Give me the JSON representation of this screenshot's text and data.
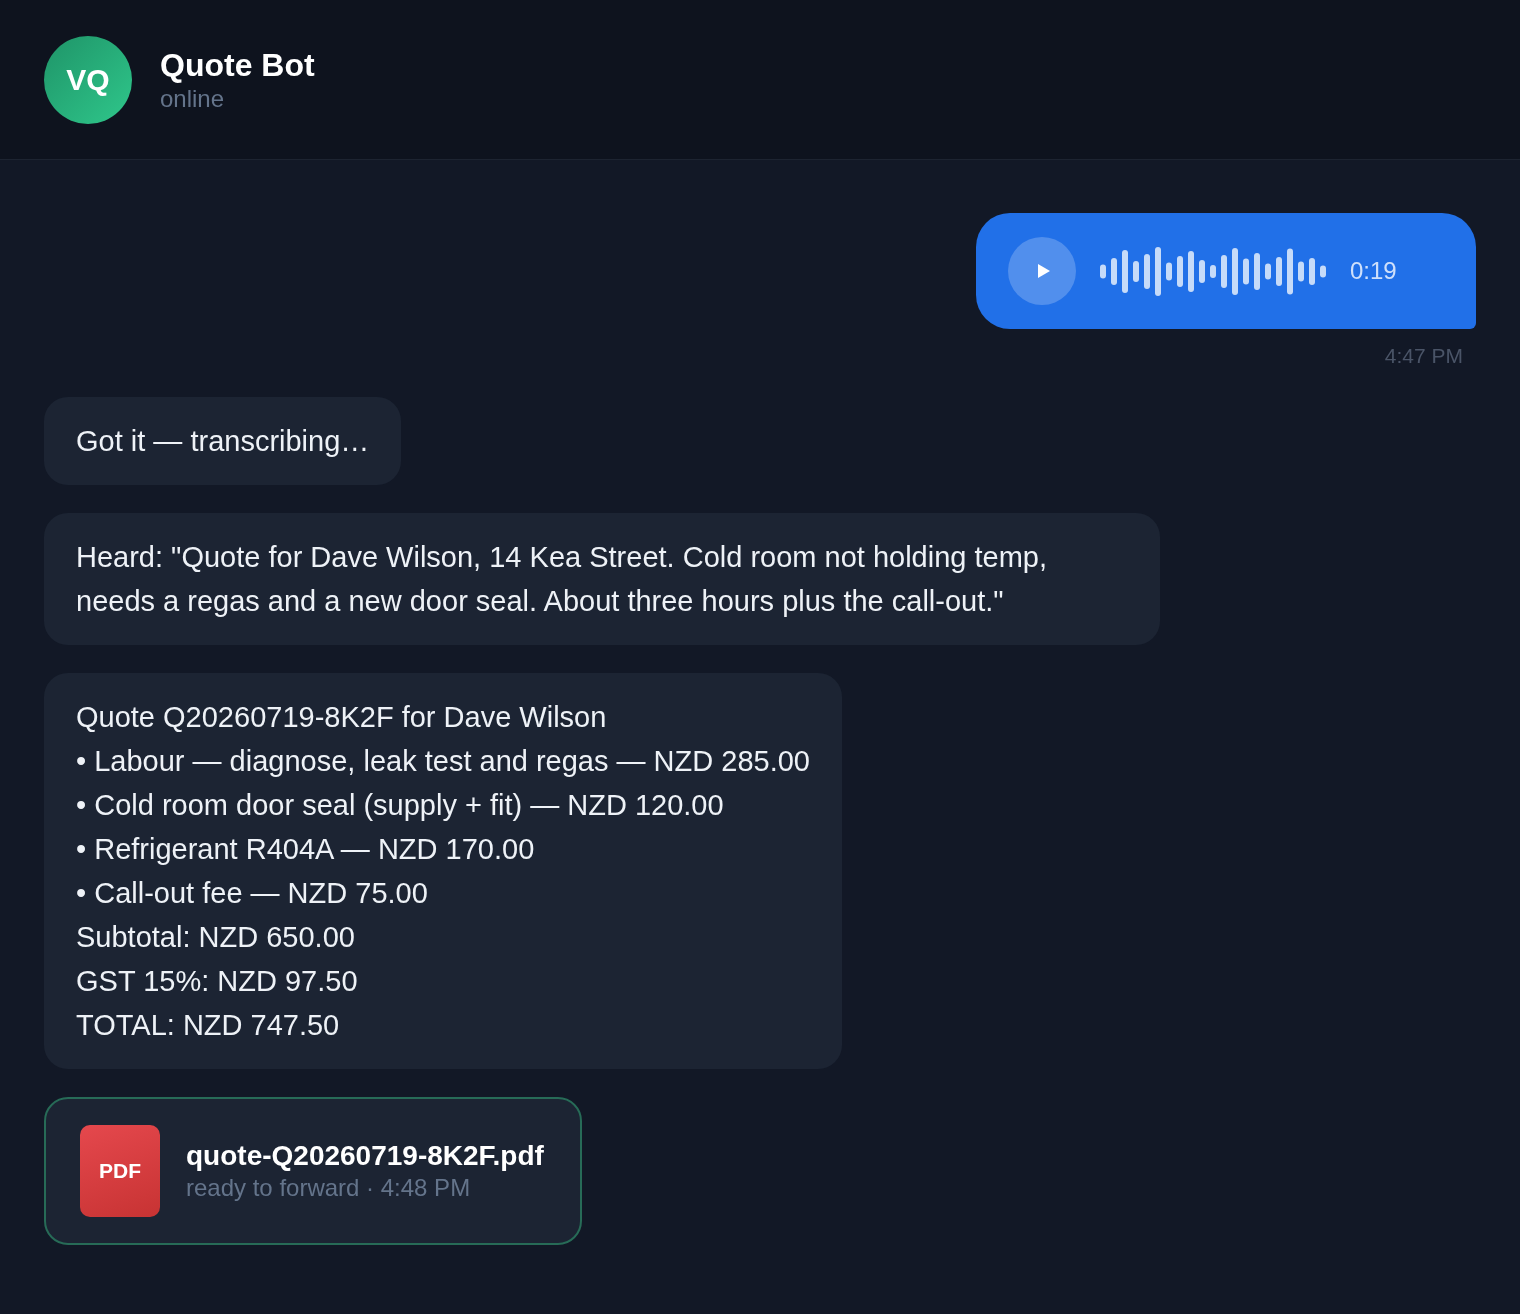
{
  "header": {
    "avatar_initials": "VQ",
    "title": "Quote Bot",
    "status": "online"
  },
  "messages": [
    {
      "kind": "voice",
      "outgoing": true,
      "duration": "0:19",
      "time": "4:47 PM"
    },
    {
      "kind": "text",
      "outgoing": false,
      "lines": [
        "Got it — transcribing…"
      ]
    },
    {
      "kind": "text",
      "outgoing": false,
      "lines": [
        "Heard: \"Quote for Dave Wilson, 14 Kea Street. Cold room not holding temp, needs a regas and a new door seal. About three hours plus the call-out.\""
      ]
    },
    {
      "kind": "text",
      "outgoing": false,
      "lines": [
        "Quote Q20260719-8K2F for Dave Wilson",
        "• Labour — diagnose, leak test and regas — NZD 285.00",
        "• Cold room door seal (supply + fit) — NZD 120.00",
        "• Refrigerant R404A — NZD 170.00",
        "• Call-out fee — NZD 75.00",
        "Subtotal: NZD 650.00",
        "GST 15%: NZD 97.50",
        "TOTAL: NZD 747.50"
      ]
    },
    {
      "kind": "file",
      "outgoing": false,
      "file_type": "PDF",
      "file_name": "quote-Q20260719-8K2F.pdf",
      "caption": "ready to forward · 4:48 PM"
    }
  ]
}
